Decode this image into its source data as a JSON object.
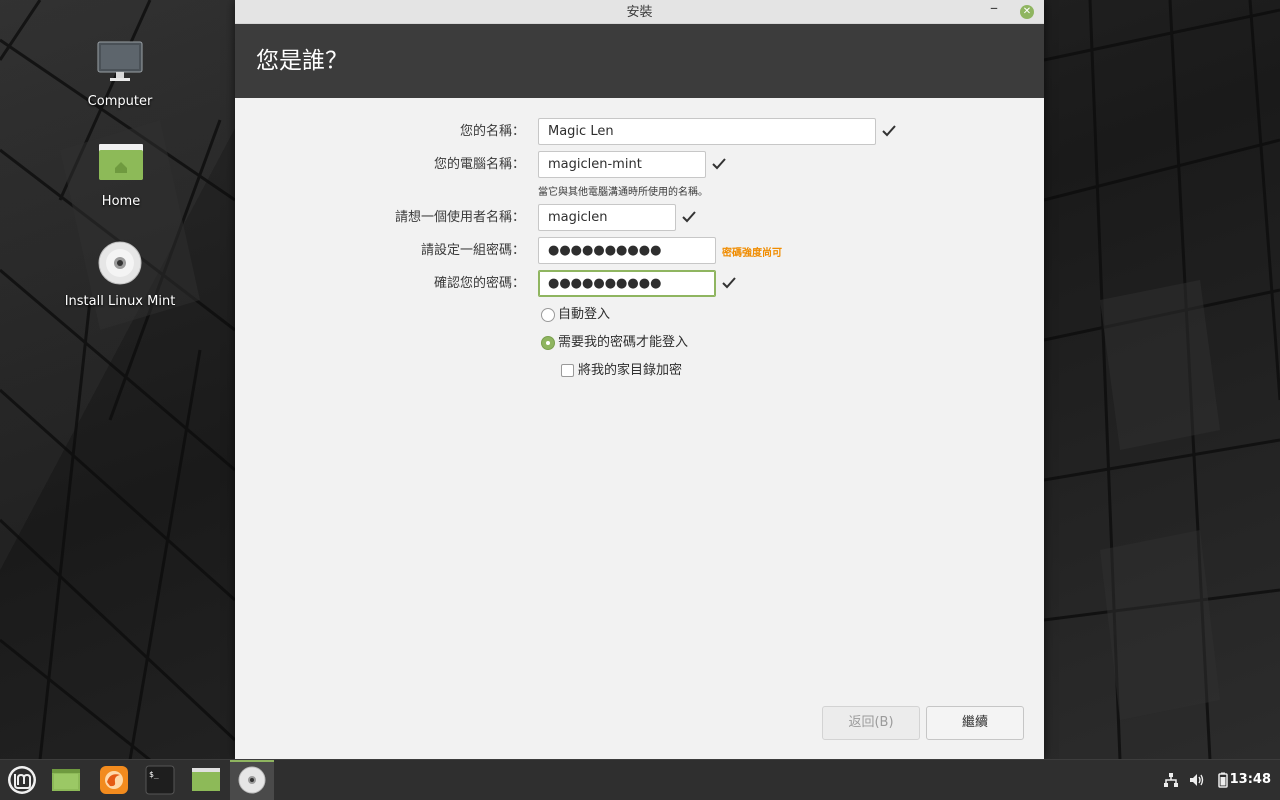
{
  "desktop": {
    "icons": [
      {
        "label": "Computer",
        "icon": "monitor-icon"
      },
      {
        "label": "Home",
        "icon": "folder-home-icon"
      },
      {
        "label": "Install Linux Mint",
        "icon": "disc-icon"
      }
    ]
  },
  "window": {
    "title": "安裝",
    "heading": "您是誰？",
    "fields": {
      "name": {
        "label": "您的名稱：",
        "value": "Magic Len"
      },
      "computer": {
        "label": "您的電腦名稱：",
        "value": "magiclen-mint",
        "hint": "當它與其他電腦溝通時所使用的名稱。"
      },
      "username": {
        "label": "請想一個使用者名稱：",
        "value": "magiclen"
      },
      "password": {
        "label": "請設定一組密碼：",
        "value": "●●●●●●●●●●",
        "strength": "密碼強度尚可"
      },
      "confirm": {
        "label": "確認您的密碼：",
        "value": "●●●●●●●●●●"
      }
    },
    "options": {
      "auto_login": {
        "label": "自動登入",
        "selected": false
      },
      "require_password": {
        "label": "需要我的密碼才能登入",
        "selected": true
      },
      "encrypt_home": {
        "label": "將我的家目錄加密",
        "checked": false
      }
    },
    "buttons": {
      "back": "返回(B)",
      "continue": "繼續"
    }
  },
  "taskbar": {
    "apps": [
      "mint-menu-icon",
      "files-icon",
      "firefox-icon",
      "terminal-icon",
      "folder-icon",
      "installer-disc-icon"
    ],
    "tray": [
      "network-icon",
      "volume-icon",
      "battery-icon"
    ],
    "clock": "13:48"
  },
  "colors": {
    "accent": "#8fb560",
    "header_bg": "#3c3c3c",
    "strength_warning": "#f08c00"
  }
}
